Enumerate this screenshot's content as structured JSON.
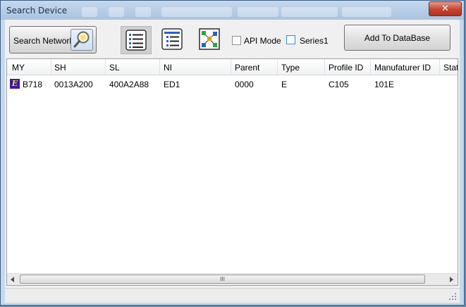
{
  "window": {
    "title": "Search Device",
    "close_symbol": "✕"
  },
  "toolbar": {
    "search_label": "Search Network",
    "api_mode_label": "API Mode",
    "api_mode_checked": false,
    "series1_label": "Series1",
    "series1_checked": false,
    "add_label": "Add To DataBase"
  },
  "table": {
    "columns": [
      "MY",
      "SH",
      "SL",
      "NI",
      "Parent",
      "Type",
      "Profile ID",
      "Manufaturer ID",
      "Statu"
    ],
    "rows": [
      {
        "badge": "E",
        "my": "B718",
        "sh": "0013A200",
        "sl": "400A2A88",
        "ni": "ED1",
        "parent": "0000",
        "type": "E",
        "profile_id": "C105",
        "manufacturer_id": "101E"
      }
    ]
  },
  "scrollbar": {
    "thumb_grip": "III"
  },
  "colors": {
    "accent": "#3a1aa6",
    "badge_text": "#ffd23a",
    "close": "#c3452f"
  }
}
